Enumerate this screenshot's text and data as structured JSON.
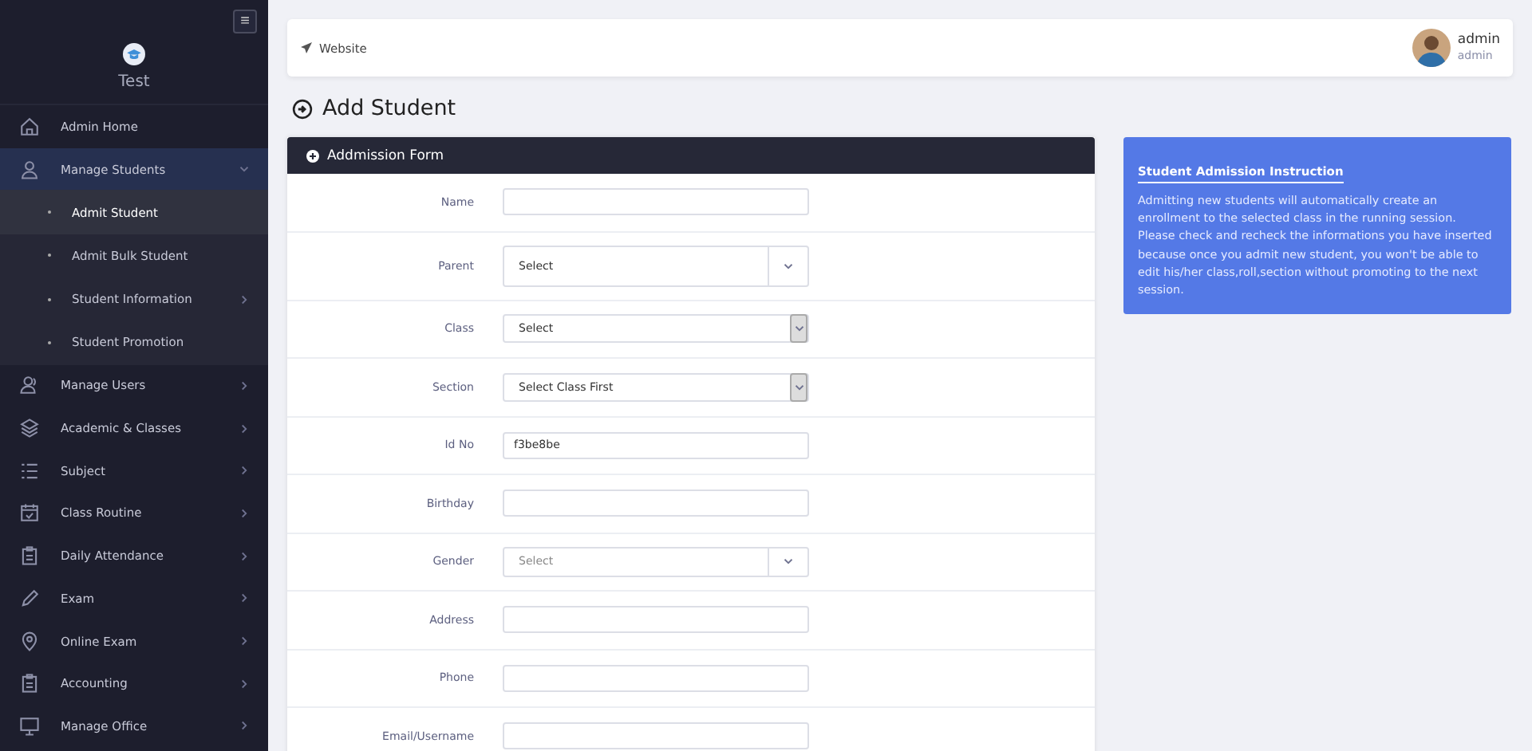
{
  "sidebar": {
    "menu_button": "≡",
    "school": "Test",
    "items": [
      {
        "label": "Admin Home",
        "expandable": false,
        "selected": false
      },
      {
        "label": "Manage Students",
        "expandable": true,
        "expanded": true,
        "selected": true,
        "children": [
          {
            "label": "Admit Student",
            "selected": true,
            "expandable": false
          },
          {
            "label": "Admit Bulk Student",
            "selected": false,
            "expandable": false
          },
          {
            "label": "Student Information",
            "selected": false,
            "expandable": true
          },
          {
            "label": "Student Promotion",
            "selected": false,
            "expandable": false
          }
        ]
      },
      {
        "label": "Manage Users",
        "expandable": true,
        "expanded": false,
        "selected": false
      },
      {
        "label": "Academic & Classes",
        "expandable": true,
        "expanded": false,
        "selected": false
      },
      {
        "label": "Subject",
        "expandable": true,
        "expanded": false,
        "selected": false
      },
      {
        "label": "Class Routine",
        "expandable": true,
        "expanded": false,
        "selected": false
      },
      {
        "label": "Daily Attendance",
        "expandable": true,
        "expanded": false,
        "selected": false
      },
      {
        "label": "Exam",
        "expandable": true,
        "expanded": false,
        "selected": false
      },
      {
        "label": "Online Exam",
        "expandable": true,
        "expanded": false,
        "selected": false
      },
      {
        "label": "Accounting",
        "expandable": true,
        "expanded": false,
        "selected": false
      },
      {
        "label": "Manage Office",
        "expandable": true,
        "expanded": false,
        "selected": false
      }
    ]
  },
  "topbar": {
    "link": "Website",
    "user_name": "admin",
    "user_role": "admin"
  },
  "page_title": "Add Student",
  "form": {
    "title": "Addmission Form",
    "fields": [
      {
        "label": "Name",
        "kind": "text"
      },
      {
        "label": "Parent",
        "kind": "combo",
        "value": "Select"
      },
      {
        "label": "Class",
        "kind": "select",
        "value": "Select"
      },
      {
        "label": "Section",
        "kind": "select",
        "value": "Select Class First"
      },
      {
        "label": "Id No",
        "kind": "text",
        "value": "f3be8be"
      },
      {
        "label": "Birthday",
        "kind": "text"
      },
      {
        "label": "Gender",
        "kind": "combo",
        "placeholder": "Select"
      },
      {
        "label": "Address",
        "kind": "text"
      },
      {
        "label": "Phone",
        "kind": "text"
      },
      {
        "label": "Email/Username",
        "kind": "text"
      }
    ]
  },
  "instruction": {
    "title": "Student Admission Instruction",
    "text": "Admitting new students will automatically create an enrollment to the selected class in the running session. Please check and recheck the informations you have inserted because once you admit new student, you won't be able to edit his/her class,roll,section without promoting to the next session."
  }
}
